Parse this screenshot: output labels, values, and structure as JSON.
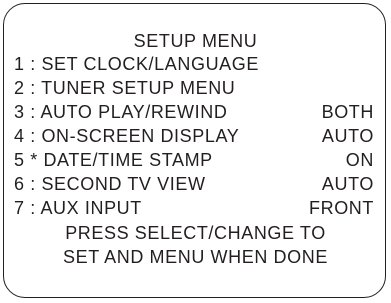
{
  "menu": {
    "title": "SETUP MENU",
    "items": [
      {
        "number": "1",
        "sep": ":",
        "label": "SET CLOCK/LANGUAGE",
        "value": ""
      },
      {
        "number": "2",
        "sep": ":",
        "label": "TUNER SETUP MENU",
        "value": ""
      },
      {
        "number": "3",
        "sep": ":",
        "label": "AUTO PLAY/REWIND",
        "value": "BOTH"
      },
      {
        "number": "4",
        "sep": ":",
        "label": "ON-SCREEN DISPLAY",
        "value": "AUTO"
      },
      {
        "number": "5",
        "sep": "*",
        "label": "DATE/TIME STAMP",
        "value": "ON"
      },
      {
        "number": "6",
        "sep": ":",
        "label": "SECOND TV VIEW",
        "value": "AUTO"
      },
      {
        "number": "7",
        "sep": ":",
        "label": "AUX INPUT",
        "value": "FRONT"
      }
    ],
    "footer": [
      "PRESS SELECT/CHANGE TO",
      "SET AND MENU WHEN DONE"
    ]
  }
}
